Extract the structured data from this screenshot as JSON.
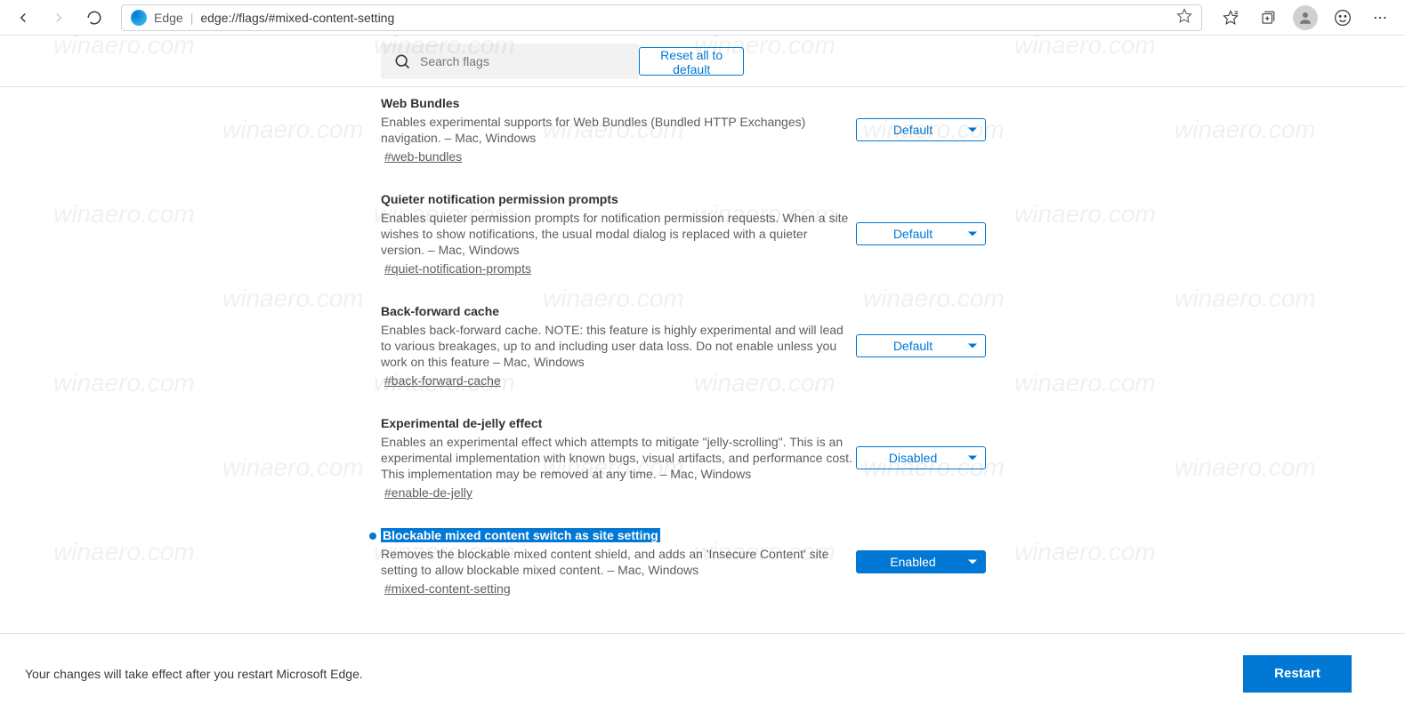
{
  "toolbar": {
    "browser_label": "Edge",
    "url": "edge://flags/#mixed-content-setting"
  },
  "header": {
    "search_placeholder": "Search flags",
    "reset_label": "Reset all to default"
  },
  "flags": [
    {
      "title": "Web Bundles",
      "desc": "Enables experimental supports for Web Bundles (Bundled HTTP Exchanges) navigation. – Mac, Windows",
      "anchor": "#web-bundles",
      "value": "Default",
      "enabled": false,
      "marker": false,
      "highlighted": false
    },
    {
      "title": "Quieter notification permission prompts",
      "desc": "Enables quieter permission prompts for notification permission requests. When a site wishes to show notifications, the usual modal dialog is replaced with a quieter version. – Mac, Windows",
      "anchor": "#quiet-notification-prompts",
      "value": "Default",
      "enabled": false,
      "marker": false,
      "highlighted": false
    },
    {
      "title": "Back-forward cache",
      "desc": "Enables back-forward cache. NOTE: this feature is highly experimental and will lead to various breakages, up to and including user data loss. Do not enable unless you work on this feature – Mac, Windows",
      "anchor": "#back-forward-cache",
      "value": "Default",
      "enabled": false,
      "marker": false,
      "highlighted": false
    },
    {
      "title": "Experimental de-jelly effect",
      "desc": "Enables an experimental effect which attempts to mitigate \"jelly-scrolling\". This is an experimental implementation with known bugs, visual artifacts, and performance cost. This implementation may be removed at any time. – Mac, Windows",
      "anchor": "#enable-de-jelly",
      "value": "Disabled",
      "enabled": false,
      "marker": false,
      "highlighted": false
    },
    {
      "title": "Blockable mixed content switch as site setting",
      "desc": "Removes the blockable mixed content shield, and adds an 'Insecure Content' site setting to allow blockable mixed content. – Mac, Windows",
      "anchor": "#mixed-content-setting",
      "value": "Enabled",
      "enabled": true,
      "marker": true,
      "highlighted": true
    }
  ],
  "footer": {
    "message": "Your changes will take effect after you restart Microsoft Edge.",
    "restart_label": "Restart"
  },
  "watermark": "winaero.com"
}
